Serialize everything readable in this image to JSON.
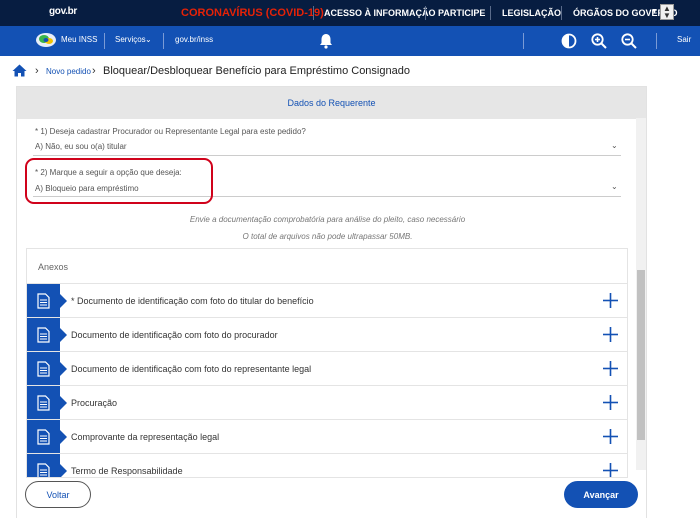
{
  "govbar": {
    "logo": "gov.br",
    "covid": "CORONAVÍRUS (COVID-19)",
    "links": [
      "ACESSO À INFORMAÇÃO",
      "PARTICIPE",
      "LEGISLAÇÃO",
      "ÓRGÃOS DO GOVERNO"
    ]
  },
  "navbar": {
    "meu_inss": "Meu INSS",
    "servicos": "Serviços",
    "url": "gov.br/inss",
    "sair": "Sair"
  },
  "breadcrumb": {
    "novo_pedido": "Novo pedido",
    "title": "Bloquear/Desbloquear Benefício para Empréstimo Consignado"
  },
  "card": {
    "header": "Dados do Requerente",
    "q1_label": "* 1) Deseja cadastrar Procurador ou Representante Legal para este pedido?",
    "q1_value": "A) Não, eu sou o(a) titular",
    "q2_label": "* 2) Marque a seguir a opção que deseja:",
    "q2_value": "A) Bloqueio para empréstimo",
    "note1": "Envie a documentação comprobatória para análise do pleito, caso necessário",
    "note2": "O total de arquivos não pode ultrapassar 50MB."
  },
  "anexos": {
    "label": "Anexos",
    "items": [
      "* Documento de identificação com foto do titular do benefício",
      "Documento de identificação com foto do procurador",
      "Documento de identificação com foto do representante legal",
      "Procuração",
      "Comprovante da representação legal",
      "Termo de Responsabilidade"
    ]
  },
  "footer": {
    "voltar": "Voltar",
    "avancar": "Avançar"
  },
  "colors": {
    "primary": "#1351b4",
    "govbar": "#071d41",
    "covid": "#e52207",
    "highlight": "#d0021b"
  }
}
